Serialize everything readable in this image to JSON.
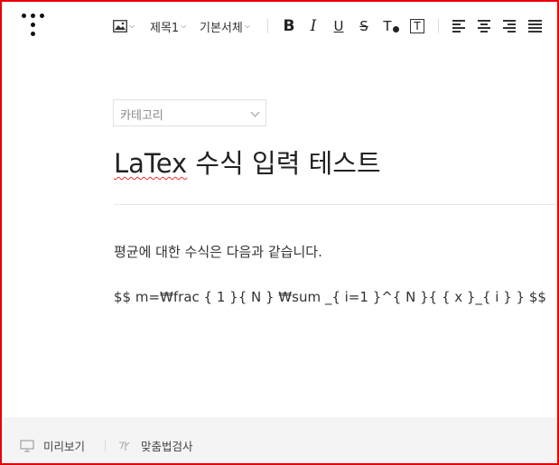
{
  "toolbar": {
    "image_label": "",
    "heading_label": "제목1",
    "font_label": "기본서체",
    "bold": "B",
    "italic": "I",
    "underline": "U",
    "strike": "S",
    "text_color": "T",
    "text_box": "T"
  },
  "editor": {
    "category_placeholder": "카테고리",
    "title_word1": "LaTex",
    "title_rest": " 수식 입력 테스트",
    "paragraphs": [
      "평균에 대한 수식은 다음과 같습니다.",
      "$$ m=₩frac { 1 }{ N } ₩sum _{ i=1 }^{ N }{ { x }_{ i } } $$"
    ]
  },
  "footer": {
    "preview_label": "미리보기",
    "spellcheck_label": "맞춤법검사"
  },
  "colors": {
    "frame_border": "#e8000a",
    "footer_bg": "#f4f4f4"
  }
}
